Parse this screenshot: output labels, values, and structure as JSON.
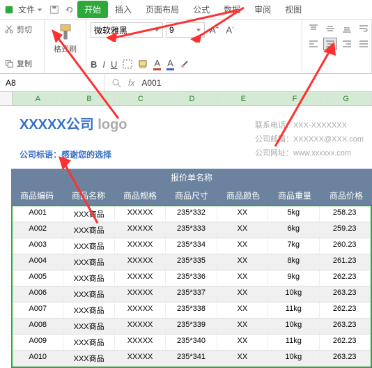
{
  "menubar": {
    "file": "文件",
    "tabs": [
      "开始",
      "插入",
      "页面布局",
      "公式",
      "数据",
      "审阅",
      "视图"
    ]
  },
  "ribbon": {
    "cut": "剪切",
    "copy": "复制",
    "paste": "格式刷",
    "font_name": "微软雅黑",
    "font_size": "9",
    "bold": "B",
    "italic": "I",
    "underline": "U",
    "font_color": "A",
    "fill_color": "A"
  },
  "addressbar": {
    "cell": "A8",
    "fx": "fx",
    "value": "A001"
  },
  "columns": [
    "A",
    "B",
    "C",
    "D",
    "E",
    "F",
    "G"
  ],
  "company": {
    "name": "XXXXX公司",
    "logo": "logo",
    "slogan": "公司标语：感谢您的选择",
    "phone_label": "联系电话：",
    "phone": "XXX-XXXXXXX",
    "email_label": "公司邮箱：",
    "email": "XXXXXX@XXX.com",
    "web_label": "公司网址：",
    "web": "www.xxxxxx.com"
  },
  "quote": {
    "title": "报价单名称",
    "headers": [
      "商品编码",
      "商品名称",
      "商品规格",
      "商品尺寸",
      "商品颜色",
      "商品重量",
      "商品价格"
    ],
    "rows": [
      [
        "A001",
        "XXX商品",
        "XXXXX",
        "235*332",
        "XX",
        "5kg",
        "258.23"
      ],
      [
        "A002",
        "XXX商品",
        "XXXXX",
        "235*333",
        "XX",
        "6kg",
        "259.23"
      ],
      [
        "A003",
        "XXX商品",
        "XXXXX",
        "235*334",
        "XX",
        "7kg",
        "260.23"
      ],
      [
        "A004",
        "XXX商品",
        "XXXXX",
        "235*335",
        "XX",
        "8kg",
        "261.23"
      ],
      [
        "A005",
        "XXX商品",
        "XXXXX",
        "235*336",
        "XX",
        "9kg",
        "262.23"
      ],
      [
        "A006",
        "XXX商品",
        "XXXXX",
        "235*337",
        "XX",
        "10kg",
        "263.23"
      ],
      [
        "A007",
        "XXX商品",
        "XXXXX",
        "235*338",
        "XX",
        "11kg",
        "262.23"
      ],
      [
        "A008",
        "XXX商品",
        "XXXXX",
        "235*339",
        "XX",
        "10kg",
        "263.23"
      ],
      [
        "A009",
        "XXX商品",
        "XXXXX",
        "235*340",
        "XX",
        "11kg",
        "262.23"
      ],
      [
        "A010",
        "XXX商品",
        "XXXXX",
        "235*341",
        "XX",
        "10kg",
        "263.23"
      ]
    ]
  }
}
